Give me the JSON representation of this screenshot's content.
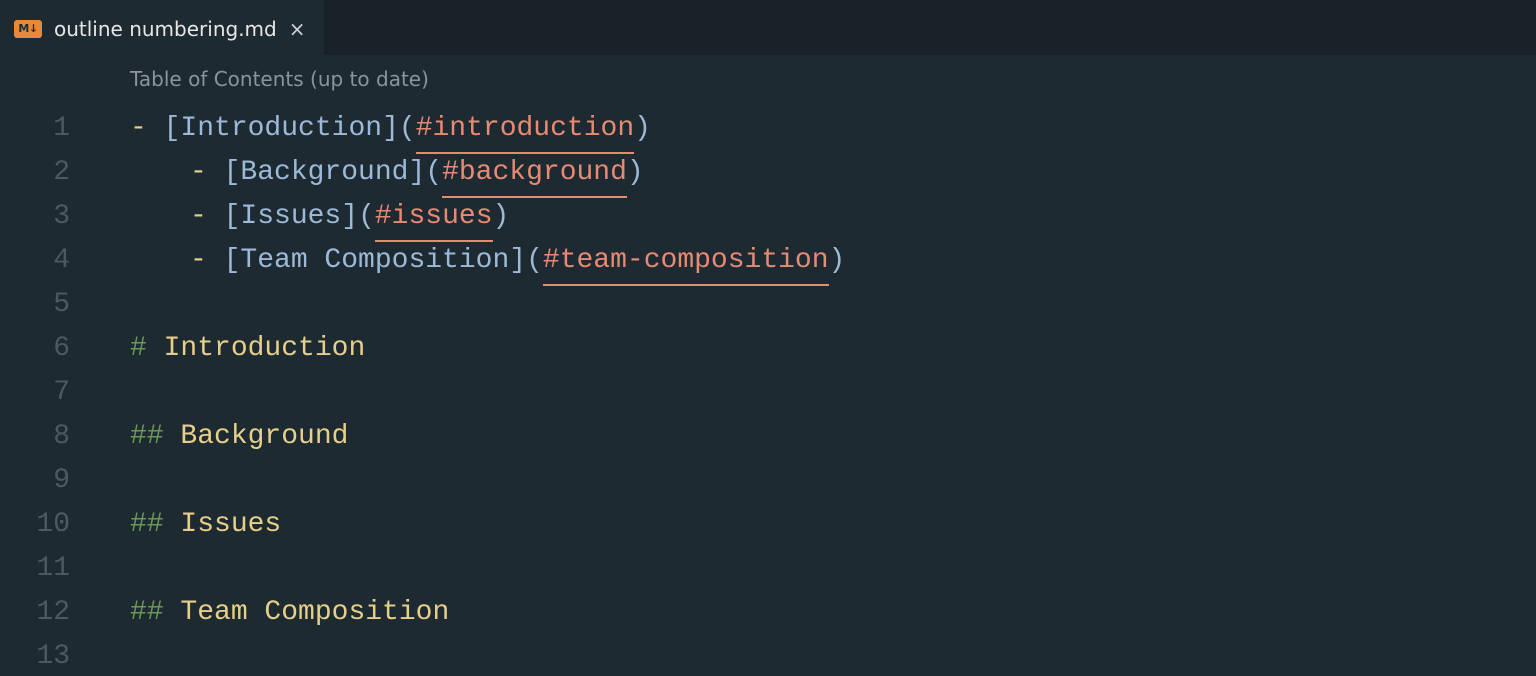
{
  "tab": {
    "icon_label": "M↓",
    "filename": "outline numbering.md",
    "close_glyph": "×"
  },
  "codelens": {
    "text": "Table of Contents (up to date)"
  },
  "gutter": {
    "n1": "1",
    "n2": "2",
    "n3": "3",
    "n4": "4",
    "n5": "5",
    "n6": "6",
    "n7": "7",
    "n8": "8",
    "n9": "9",
    "n10": "10",
    "n11": "11",
    "n12": "12",
    "n13": "13"
  },
  "toc": {
    "line1": {
      "bullet": "- ",
      "open": "[",
      "text": "Introduction",
      "close": "]",
      "lp": "(",
      "anchor": "#introduction",
      "rp": ")"
    },
    "line2": {
      "bullet": "- ",
      "open": "[",
      "text": "Background",
      "close": "]",
      "lp": "(",
      "anchor": "#background",
      "rp": ")"
    },
    "line3": {
      "bullet": "- ",
      "open": "[",
      "text": "Issues",
      "close": "]",
      "lp": "(",
      "anchor": "#issues",
      "rp": ")"
    },
    "line4": {
      "bullet": "- ",
      "open": "[",
      "text": "Team Composition",
      "close": "]",
      "lp": "(",
      "anchor": "#team-composition",
      "rp": ")"
    }
  },
  "headings": {
    "h1": {
      "hash": "# ",
      "text": "Introduction"
    },
    "h2": {
      "hash": "## ",
      "text": "Background"
    },
    "h3": {
      "hash": "## ",
      "text": "Issues"
    },
    "h4": {
      "hash": "## ",
      "text": "Team Composition"
    }
  }
}
